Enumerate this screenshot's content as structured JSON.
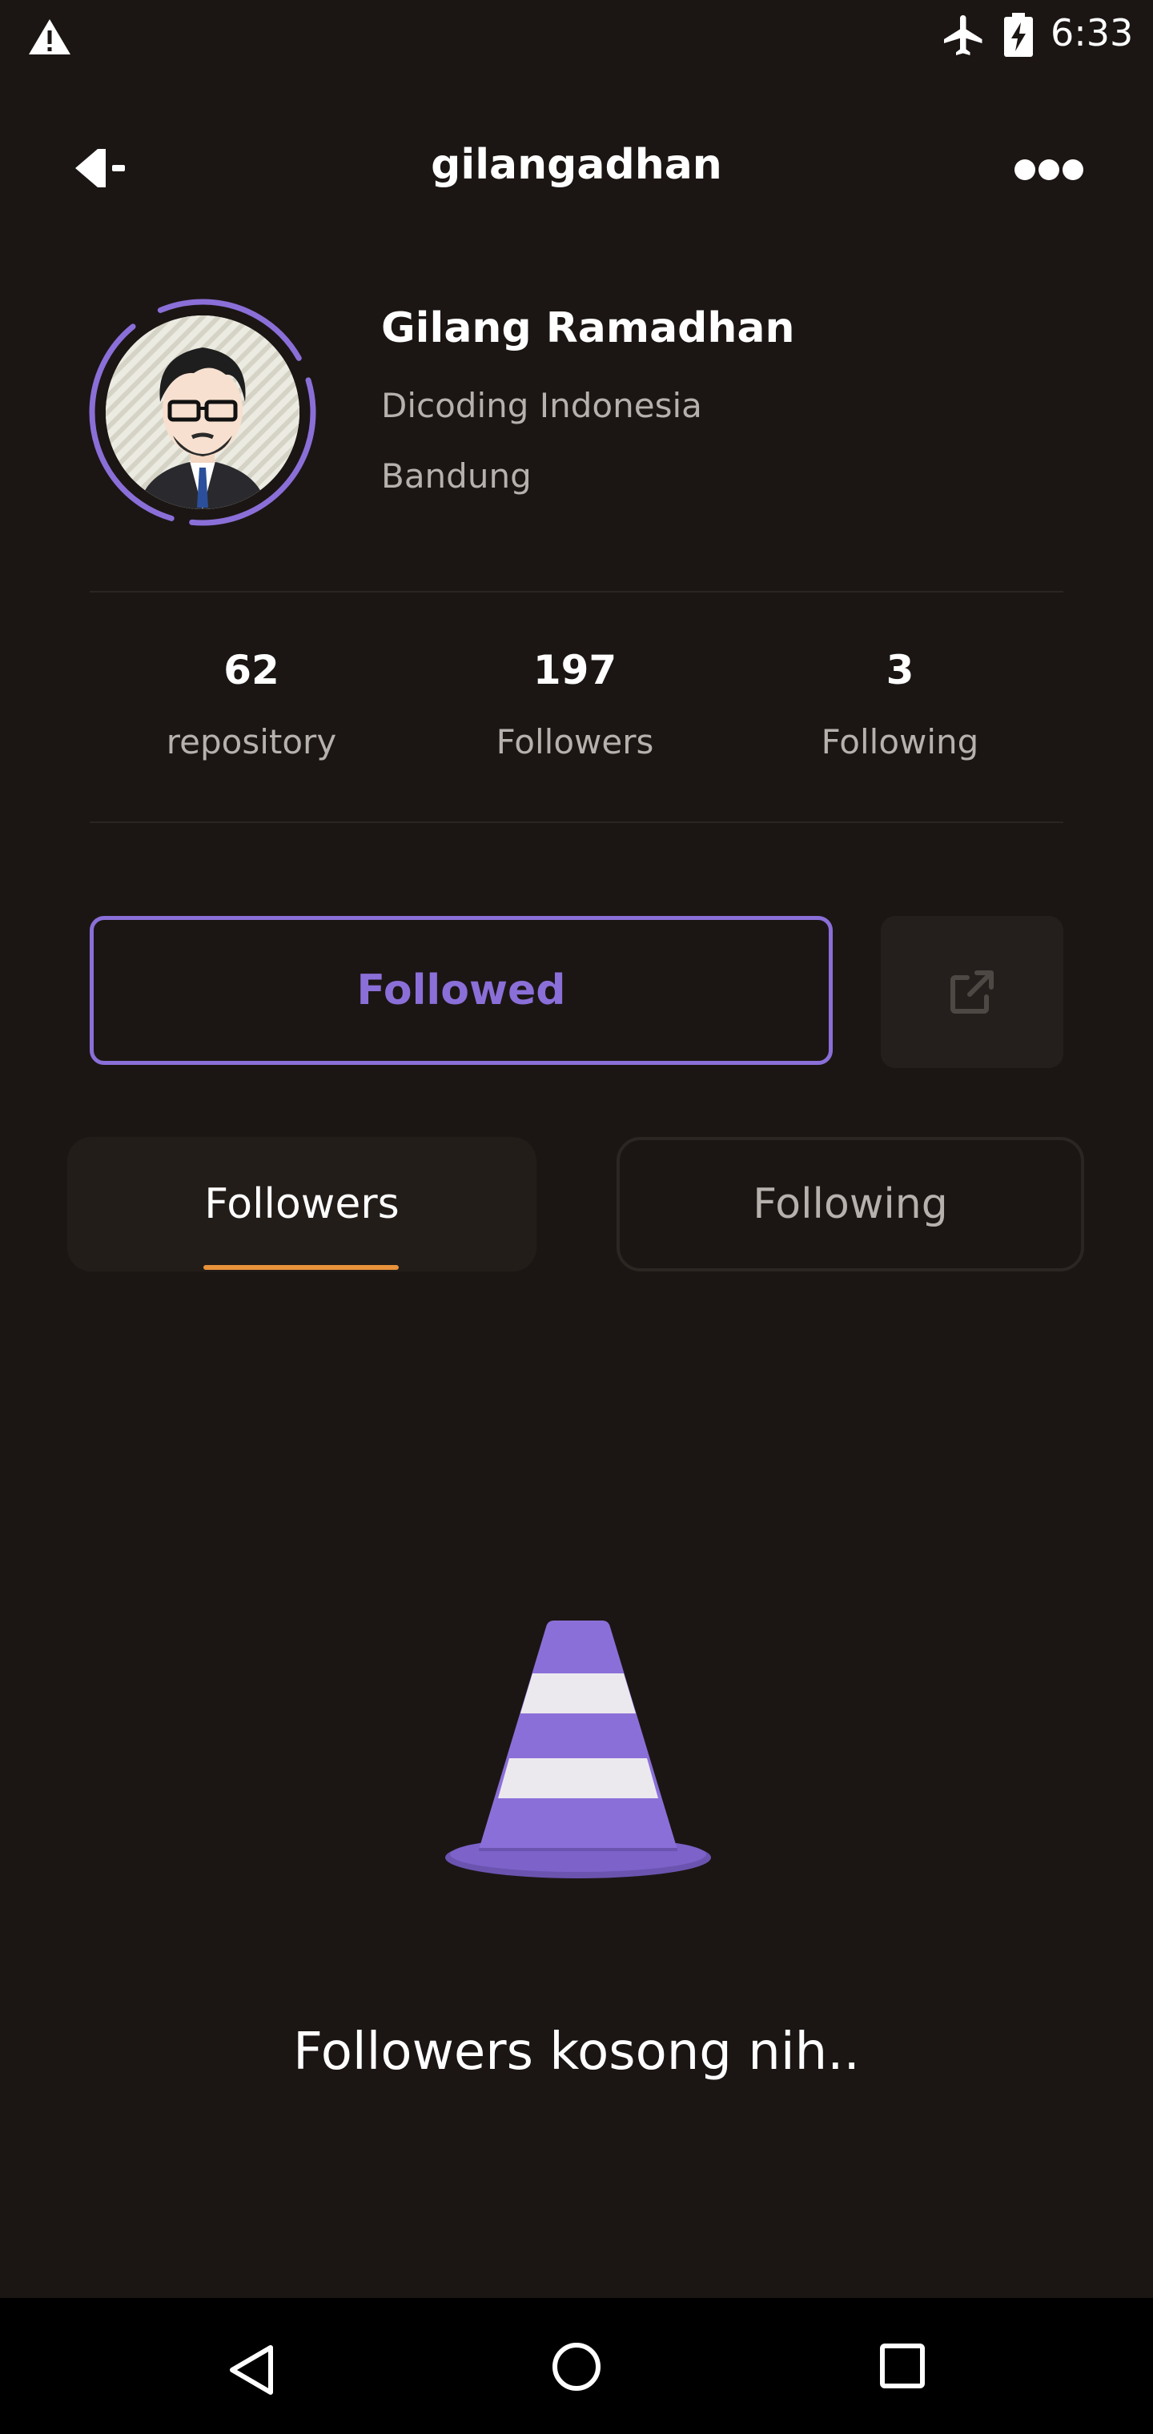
{
  "status_bar": {
    "time": "6:33",
    "icons": [
      "warning-icon",
      "airplane-mode-icon",
      "battery-charging-icon"
    ]
  },
  "app_bar": {
    "title": "gilangadhan",
    "back_icon": "back-arrow-icon",
    "more_icon": "more-dots-icon"
  },
  "profile": {
    "name": "Gilang Ramadhan",
    "company": "Dicoding Indonesia",
    "location": "Bandung",
    "avatar": "cartoon-avatar-glasses"
  },
  "stats": [
    {
      "value": "62",
      "label": "repository"
    },
    {
      "value": "197",
      "label": "Followers"
    },
    {
      "value": "3",
      "label": "Following"
    }
  ],
  "actions": {
    "follow_label": "Followed",
    "share_icon": "open-external-icon"
  },
  "tabs": [
    {
      "label": "Followers",
      "active": true
    },
    {
      "label": "Following",
      "active": false
    }
  ],
  "empty_state": {
    "message": "Followers kosong nih..",
    "illustration": "traffic-cone"
  },
  "colors": {
    "background": "#1b1614",
    "accent": "#8b6fd8",
    "tab_indicator": "#e8923a",
    "secondary_text": "#b6b1ad"
  }
}
